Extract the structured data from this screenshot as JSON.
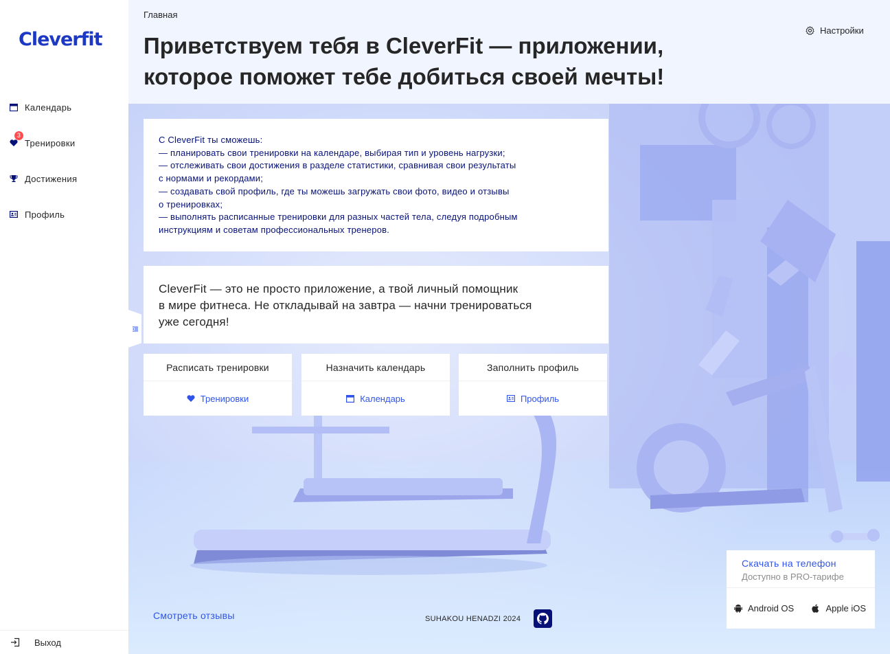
{
  "app": {
    "logo_text": "Cleverfit",
    "brand_color": "#1d39c4",
    "accent_color": "#2f54eb"
  },
  "sidebar": {
    "items": [
      {
        "label": "Календарь",
        "icon": "calendar-icon"
      },
      {
        "label": "Тренировки",
        "icon": "heart-icon",
        "badge": "3"
      },
      {
        "label": "Достижения",
        "icon": "trophy-icon"
      },
      {
        "label": "Профиль",
        "icon": "idcard-icon"
      }
    ],
    "logout_label": "Выход"
  },
  "header": {
    "breadcrumb": "Главная",
    "title": "Приветствуем тебя в CleverFit — приложении, которое поможет тебе добиться своей мечты!",
    "settings_label": "Настройки"
  },
  "main": {
    "features_text": "С CleverFit ты сможешь:\n— планировать свои тренировки на календаре, выбирая тип и уровень нагрузки;\n— отслеживать свои достижения в разделе статистики, сравнивая свои результаты\nс нормами и рекордами;\n— создавать свой профиль, где ты можешь загружать свои фото, видео и отзывы\nо тренировках;\n— выполнять расписанные тренировки для разных частей тела, следуя подробным\nинструкциям и советам профессиональных тренеров.",
    "motto_text": "CleverFit — это не просто приложение, а твой личный помощник\nв мире фитнеса. Не откладывай на завтра — начни тренироваться\nуже сегодня!",
    "actions": [
      {
        "title": "Расписать тренировки",
        "link": "Тренировки",
        "icon": "heart-icon"
      },
      {
        "title": "Назначить календарь",
        "link": "Календарь",
        "icon": "calendar-icon"
      },
      {
        "title": "Заполнить профиль",
        "link": "Профиль",
        "icon": "idcard-icon"
      }
    ]
  },
  "footer": {
    "reviews_link": "Смотреть отзывы",
    "copyright": "SUHAKOU HENADZI 2024",
    "github_icon": "github-icon"
  },
  "download": {
    "title": "Скачать на телефон",
    "subtitle": "Доступно в PRO-тарифе",
    "android_label": "Android OS",
    "ios_label": "Apple iOS"
  }
}
